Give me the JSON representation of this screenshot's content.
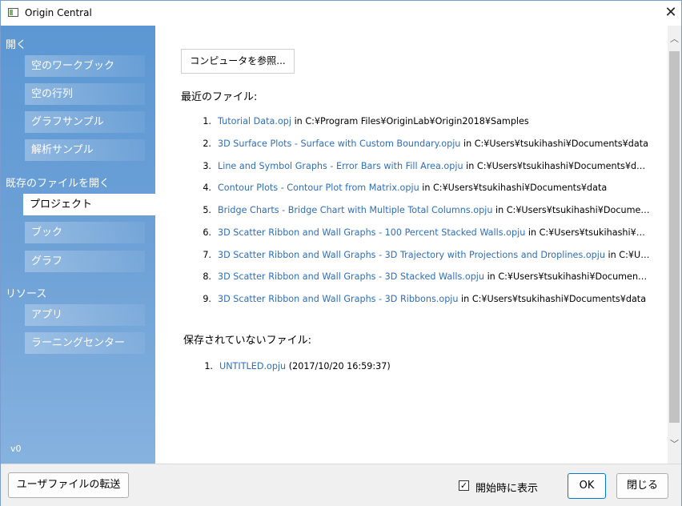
{
  "window": {
    "title": "Origin Central",
    "close_glyph": "✕"
  },
  "sidebar": {
    "open_section": "開く",
    "open_items": [
      {
        "label": "空のワークブック"
      },
      {
        "label": "空の行列"
      },
      {
        "label": "グラフサンプル"
      },
      {
        "label": "解析サンプル"
      }
    ],
    "existing_section": "既存のファイルを開く",
    "existing_items": [
      {
        "label": "プロジェクト",
        "active": true
      },
      {
        "label": "ブック",
        "active": false
      },
      {
        "label": "グラフ",
        "active": false
      }
    ],
    "resources_section": "リソース",
    "resources_items": [
      {
        "label": "アプリ"
      },
      {
        "label": "ラーニングセンター"
      }
    ],
    "version": "v0"
  },
  "content": {
    "browse_button": "コンピュータを参照...",
    "recent_heading": "最近のファイル:",
    "in_word": " in ",
    "recent_files": [
      {
        "num": "1.",
        "name": "Tutorial Data.opj",
        "path": "C:¥Program Files¥OriginLab¥Origin2018¥Samples"
      },
      {
        "num": "2.",
        "name": "3D Surface Plots - Surface with Custom Boundary.opju",
        "path": "C:¥Users¥tsukihashi¥Documents¥data"
      },
      {
        "num": "3.",
        "name": "Line and Symbol Graphs - Error Bars with Fill Area.opju",
        "path": "C:¥Users¥tsukihashi¥Documents¥data"
      },
      {
        "num": "4.",
        "name": "Contour Plots - Contour Plot from Matrix.opju",
        "path": "C:¥Users¥tsukihashi¥Documents¥data"
      },
      {
        "num": "5.",
        "name": "Bridge Charts - Bridge Chart with Multiple Total Columns.opju",
        "path": "C:¥Users¥tsukihashi¥Documen…"
      },
      {
        "num": "6.",
        "name": "3D Scatter Ribbon and Wall Graphs - 100 Percent Stacked Walls.opju",
        "path": "C:¥Users¥tsukihashi¥Do…"
      },
      {
        "num": "7.",
        "name": "3D Scatter Ribbon and Wall Graphs - 3D Trajectory with Projections and Droplines.opju",
        "path": "C:¥Us…"
      },
      {
        "num": "8.",
        "name": "3D Scatter Ribbon and Wall Graphs - 3D Stacked Walls.opju",
        "path": "C:¥Users¥tsukihashi¥Documents…"
      },
      {
        "num": "9.",
        "name": "3D Scatter Ribbon and Wall Graphs - 3D Ribbons.opju",
        "path": "C:¥Users¥tsukihashi¥Documents¥data"
      }
    ],
    "unsaved_heading": "保存されていないファイル:",
    "unsaved_files": [
      {
        "num": "1.",
        "name": "UNTITLED.opju",
        "info": " (2017/10/20 16:59:37)"
      }
    ]
  },
  "scrollbar": {
    "up_glyph": "︿",
    "down_glyph": "﹀"
  },
  "footer": {
    "transfer_button": "ユーザファイルの転送",
    "show_on_start_label": "開始時に表示",
    "show_on_start_checked": true,
    "check_glyph": "✓",
    "ok_button": "OK",
    "close_button": "閉じる"
  },
  "colors": {
    "sidebar_top": "#5c97d3",
    "sidebar_bottom": "#86b2df",
    "link": "#2f6fb8",
    "ok_border": "#0078d7"
  }
}
